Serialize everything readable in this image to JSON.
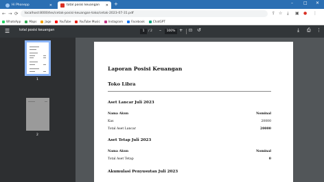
{
  "browser": {
    "tabs": [
      {
        "label": "Hi Phonepp",
        "icon": "globe-icon",
        "active": false
      },
      {
        "label": "total posisi keuangan",
        "icon": "pdf-icon",
        "active": true
      }
    ],
    "new_tab": "+",
    "window_controls": {
      "minimize": "–",
      "maximize": "□",
      "close": "✕"
    },
    "nav": {
      "back": "←",
      "forward": "→",
      "reload": "⟳"
    },
    "url": "localhost:8000/tes/cetak-posisi-keuangan-toko/cetak-2023-07-31.pdf",
    "bookmarks": [
      {
        "label": "WhatsApp",
        "color": "#25d366"
      },
      {
        "label": "Maps",
        "color": "#34a853"
      },
      {
        "label": "Jago",
        "color": "#f4a300"
      },
      {
        "label": "YouTube",
        "color": "#ff0000"
      },
      {
        "label": "YouTube Music",
        "color": "#e62117"
      },
      {
        "label": "Instagram",
        "color": "#c13584"
      },
      {
        "label": "Facebook",
        "color": "#1877f2"
      },
      {
        "label": "ChatGPT",
        "color": "#10a37f"
      }
    ]
  },
  "pdf_toolbar": {
    "title": "total posisi keuangan",
    "page_current": "1",
    "page_total": "/ 2",
    "zoom": "100%",
    "menu_icon": "☰",
    "zoom_out": "–",
    "zoom_in": "+",
    "fit_icon": "⊡",
    "rotate_icon": "↺",
    "download_icon": "⤓",
    "print_icon": "⎙",
    "more_icon": "⋮"
  },
  "thumbnails": [
    {
      "page": "1",
      "selected": true
    },
    {
      "page": "2",
      "selected": false
    }
  ],
  "document": {
    "title": "Laporan Posisi Keuangan",
    "subtitle": "Toko Libra",
    "sections": [
      {
        "heading": "Aset Lancar Juli 2023",
        "header_left": "Nama Akun",
        "header_right": "Nominal",
        "rows": [
          {
            "name": "Kas",
            "value": "20000"
          }
        ],
        "total_label": "Total Aset Lancar",
        "total_value": "20000"
      },
      {
        "heading": "Aset Tetap Juli 2023",
        "header_left": "Nama Akun",
        "header_right": "Nominal",
        "rows": [],
        "total_label": "Total Aset Tetap",
        "total_value": "0"
      },
      {
        "heading": "Akumulasi Penyusutan Juli 2023"
      }
    ]
  }
}
